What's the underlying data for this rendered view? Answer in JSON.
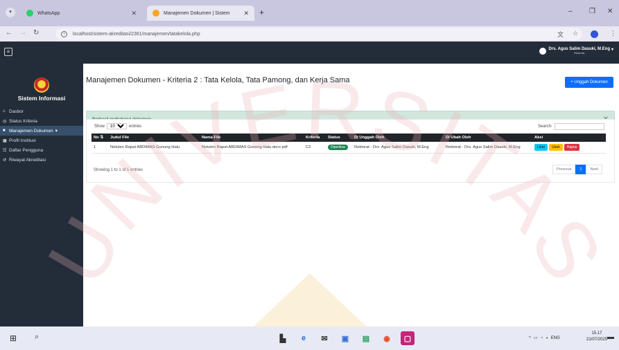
{
  "browser": {
    "tabs": [
      {
        "label": "WhatsApp",
        "active": false
      },
      {
        "label": "Manajemen Dokumen | Sistem",
        "active": true
      }
    ],
    "url": "localhost/sistem-akreditasi/2361/manajemen/tatakelola.php"
  },
  "app": {
    "brand": "Sistem Informasi",
    "user_name": "Drs. Agus Salim Dasuki, M.Eng",
    "user_role": "Rektorat"
  },
  "sidebar": {
    "items": [
      {
        "label": "Dasbor",
        "icon": "home-icon",
        "active": false
      },
      {
        "label": "Status Kriteria",
        "icon": "clock-icon",
        "active": false
      },
      {
        "label": "Manajemen Dokumen",
        "icon": "folder-icon",
        "active": true
      },
      {
        "label": "Profil Institusi",
        "icon": "building-icon",
        "active": false
      },
      {
        "label": "Daftar Pengguna",
        "icon": "users-icon",
        "active": false
      },
      {
        "label": "Riwayat Akreditasi",
        "icon": "history-icon",
        "active": false
      }
    ]
  },
  "main": {
    "title": "Manajemen Dokumen - Kriteria 2 : Tata Kelola, Tata Pamong, dan Kerja Sama",
    "upload_button": "+ Unggah Dokumen",
    "alert": "Berhasil perbaharui dokumen",
    "show_label": "Show",
    "entries_value": "10",
    "entries_label": "entries",
    "search_label": "Search:",
    "table": {
      "headers": [
        "No",
        "Judul File",
        "Nama File",
        "Kriteria",
        "Status",
        "Di Unggah Oleh",
        "Di Ubah Oleh",
        "Aksi"
      ],
      "rows": [
        {
          "no": "1",
          "judul": "Notulen Rapat ABDIMAS Gunung Halu",
          "nama": "Notulen Rapat ABDIMAS Gunung Halu.docx.pdf",
          "kriteria": "C2",
          "status": "Diperiksa",
          "unggah": "Rektorat - Drs. Agus Salim Dasuki, M.Eng",
          "ubah": "Rektorat - Drs. Agus Salim Dasuki, M.Eng",
          "actions": [
            "Lihat",
            "Ubah",
            "Hapus"
          ]
        }
      ]
    },
    "info": "Showing 1 to 1 of 1 entries",
    "pager": {
      "prev": "Previous",
      "current": "1",
      "next": "Next"
    }
  },
  "watermark": "UNIVERSITAS",
  "taskbar": {
    "lang": "ENG",
    "time": "15.17",
    "date": "21/07/2025"
  },
  "colors": {
    "sidebar": "#232d3a",
    "primary": "#0d6efd",
    "success": "#198754",
    "alert_bg": "#d1e7dd"
  }
}
